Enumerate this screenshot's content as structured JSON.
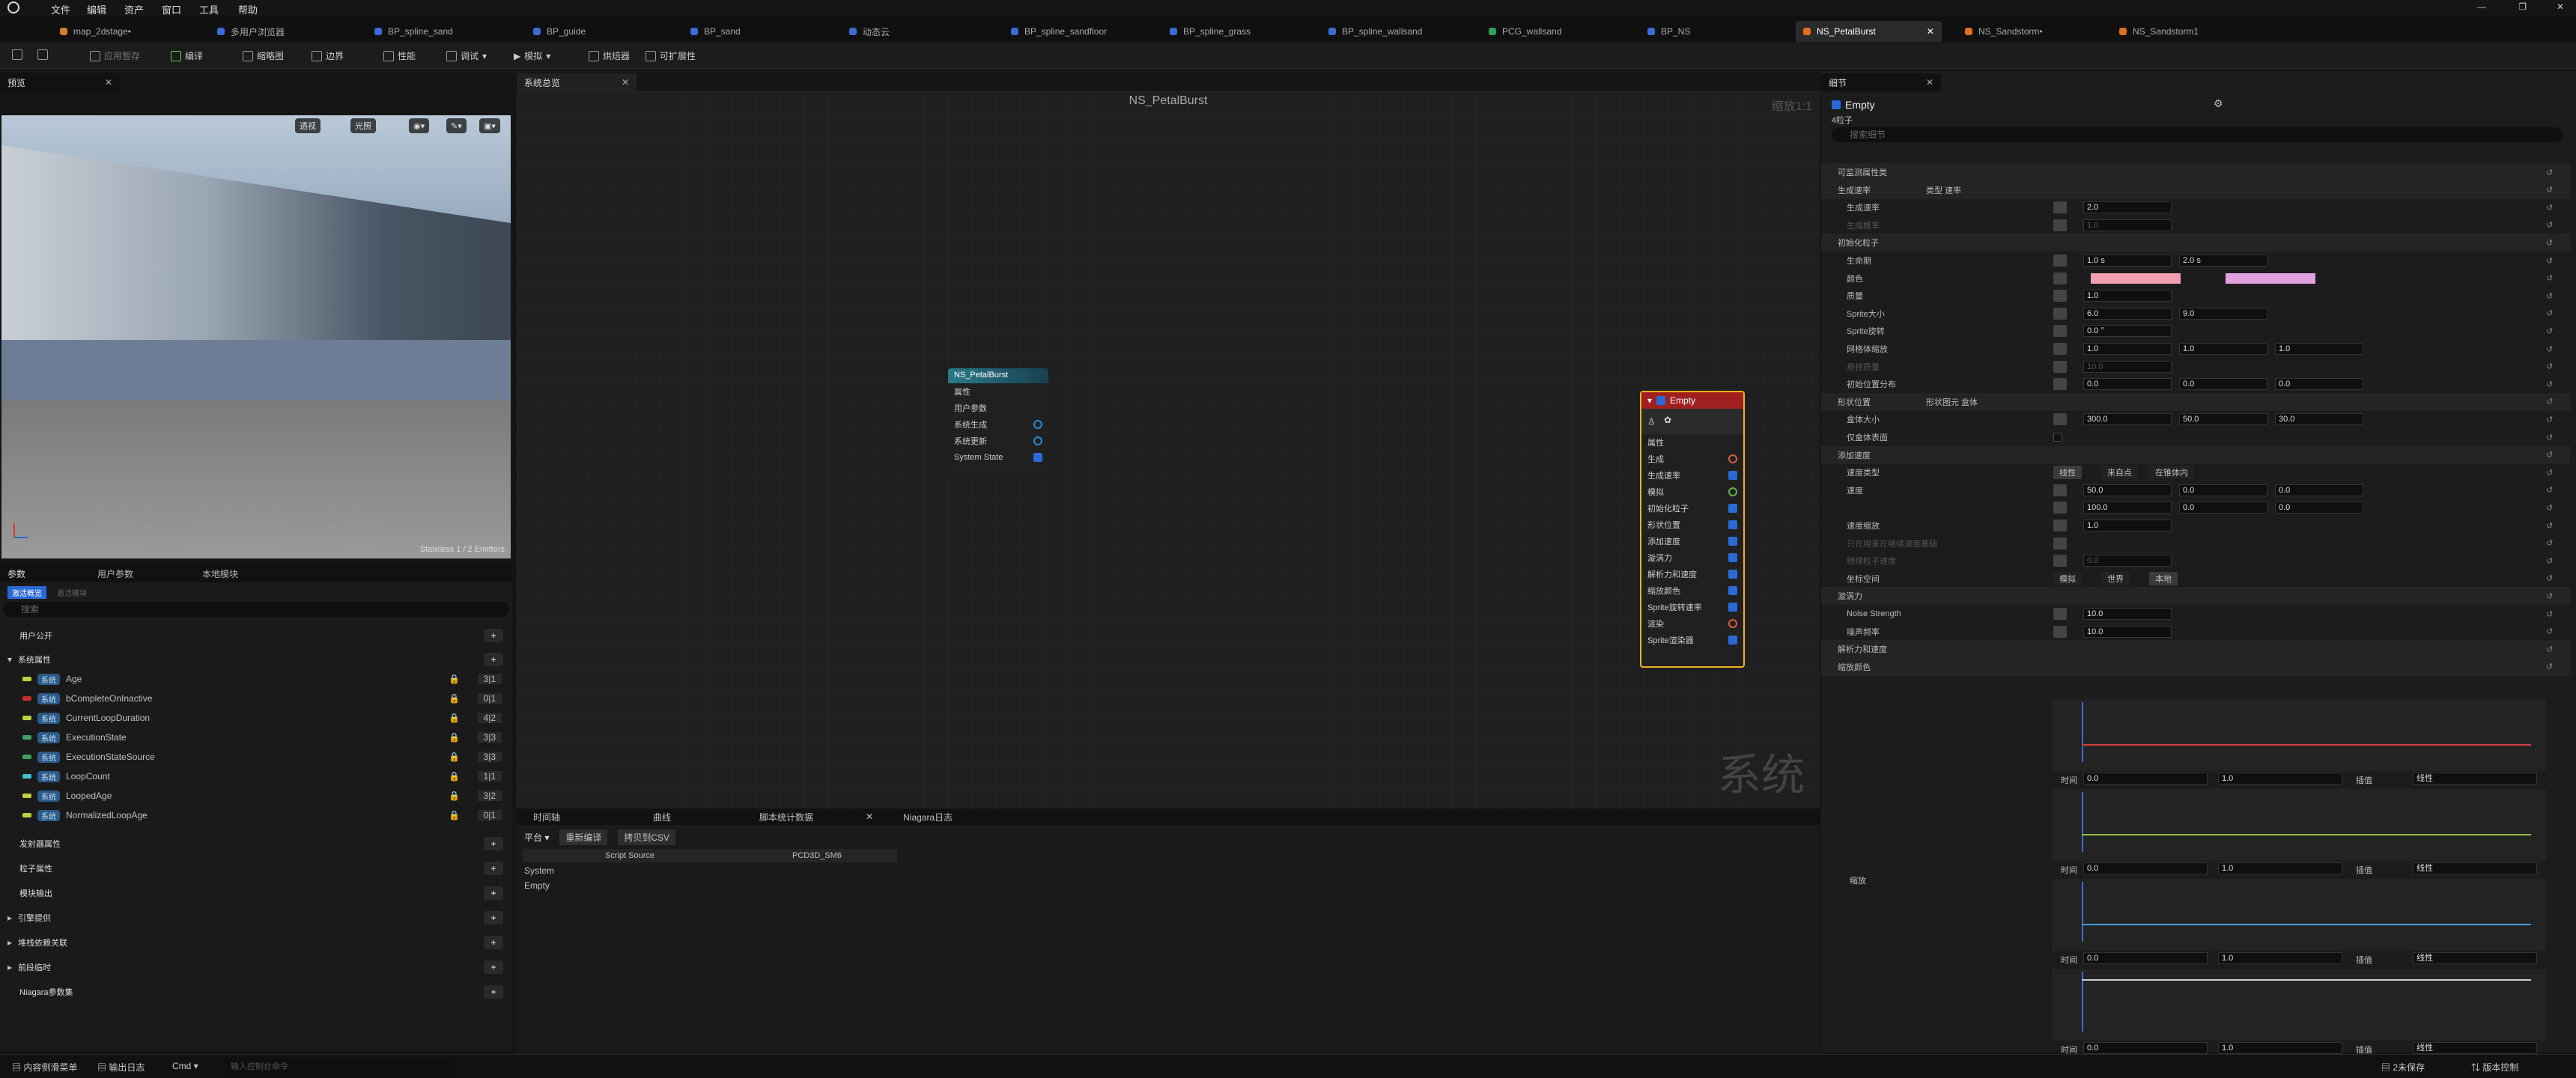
{
  "menu": [
    "文件",
    "编辑",
    "资产",
    "窗口",
    "工具",
    "帮助"
  ],
  "tabs": [
    "map_2dstage•",
    "多用户浏览器",
    "BP_spline_sand",
    "BP_guide",
    "BP_sand",
    "动态云",
    "BP_spline_sandfloor",
    "BP_spline_grass",
    "BP_spline_wallsand",
    "PCG_wallsand",
    "BP_NS",
    "NS_PetalBurst",
    "NS_Sandstorm•",
    "NS_Sandstorm1"
  ],
  "toolbar": {
    "apply": "应用暂存",
    "compile": "编译",
    "thumbnail": "缩略图",
    "bounds": "边界",
    "perf": "性能",
    "debug": "调试",
    "simulate": "模拟",
    "baker": "烘焙器",
    "scalability": "可扩展性"
  },
  "preview": {
    "title": "预览",
    "perspective": "透视",
    "lit": "光照",
    "stats": "Stateless 1 / 2 Emitters"
  },
  "params": {
    "title": "参数",
    "user_tab": "用户参数",
    "local_tab": "本地模块",
    "active_tab": "激活概览",
    "inactive_tab": "激活模块",
    "search_placeholder": "搜索",
    "user_exposed": "用户公开",
    "system_attr": "系统属性",
    "emitter_attr": "发射器属性",
    "particle_attr": "粒子属性",
    "module_output": "模块输出",
    "engine_provided": "引擎提供",
    "transient_assoc": "堆栈依赖关联",
    "before_temp": "前段临时",
    "niagara_params": "Niagara参数集",
    "attrs": [
      {
        "name": "Age",
        "count": "3|1",
        "color": "#c0d040"
      },
      {
        "name": "bCompleteOnInactive",
        "count": "0|1",
        "color": "#c03030"
      },
      {
        "name": "CurrentLoopDuration",
        "count": "4|2",
        "color": "#c0d040"
      },
      {
        "name": "ExecutionState",
        "count": "3|3",
        "color": "#40a060"
      },
      {
        "name": "ExecutionStateSource",
        "count": "3|3",
        "color": "#40a060"
      },
      {
        "name": "LoopCount",
        "count": "1|1",
        "color": "#40c0d0"
      },
      {
        "name": "LoopedAge",
        "count": "3|2",
        "color": "#c0d040"
      },
      {
        "name": "NormalizedLoopAge",
        "count": "0|1",
        "color": "#c0d040"
      }
    ],
    "sys_tag": "系统"
  },
  "graph": {
    "tab": "系统总览",
    "title": "NS_PetalBurst",
    "zoom": "缩放1:1",
    "watermark": "系统",
    "sys_node": {
      "title": "NS_PetalBurst",
      "rows": [
        "属性",
        "用户参数",
        "系统生成",
        "系统更新",
        "System State"
      ]
    },
    "emit_node": {
      "title": "Empty",
      "rows": [
        "属性",
        "生成",
        "生成速率",
        "模拟",
        "初始化粒子",
        "形状位置",
        "添加速度",
        "漩涡力",
        "解析力和速度",
        "缩放颜色",
        "Sprite旋转速率",
        "渲染",
        "Sprite渲染器"
      ]
    }
  },
  "bottom": {
    "tabs": [
      "时间轴",
      "曲线",
      "脚本统计数据",
      "Niagara日志"
    ],
    "platform": "平台",
    "recompile": "重新编译",
    "copy_csv": "拷贝到CSV",
    "col1": "Script Source",
    "col2": "PCD3D_SM6",
    "rows": [
      "System",
      "Empty"
    ]
  },
  "details": {
    "title": "细节",
    "emitter": "Empty",
    "count": "4粒子",
    "search_placeholder": "搜索细节",
    "rows": [
      {
        "l": "可监测属性类",
        "s": 1
      },
      {
        "l": "生成速率",
        "s": 1,
        "extra": "类型  速率"
      },
      {
        "l": "生成速率",
        "v": "2.0"
      },
      {
        "l": "生成概率",
        "v": "1.0",
        "dim": 1
      },
      {
        "l": "初始化粒子",
        "s": 1
      },
      {
        "l": "生命期",
        "v": "1.0 s",
        "v2": "2.0 s"
      },
      {
        "l": "颜色",
        "color": 1
      },
      {
        "l": "质量",
        "v": "1.0"
      },
      {
        "l": "Sprite大小",
        "v": "6.0",
        "v2": "9.0"
      },
      {
        "l": "Sprite旋转",
        "v": "0.0 °"
      },
      {
        "l": "网格体缩放",
        "v": "1.0",
        "v2": "1.0",
        "v3": "1.0"
      },
      {
        "l": "悬挂质量",
        "v": "10.0",
        "dim": 1
      },
      {
        "l": "初始位置分布",
        "v": "0.0",
        "v2": "0.0",
        "v3": "0.0"
      },
      {
        "l": "形状位置",
        "s": 1,
        "extra": "形状图元  盒体"
      },
      {
        "l": "盒体大小",
        "v": "300.0",
        "v2": "50.0",
        "v3": "30.0"
      },
      {
        "l": "仅盒体表面"
      },
      {
        "l": "添加速度",
        "s": 1
      },
      {
        "l": "速度类型",
        "mode": [
          "线性",
          "来自点",
          "在锥体内"
        ]
      },
      {
        "l": "速度",
        "v": "50.0",
        "v2": "0.0",
        "v3": "0.0"
      },
      {
        "l": "",
        "v": "100.0",
        "v2": "0.0",
        "v3": "0.0"
      },
      {
        "l": "速度缩放",
        "v": "1.0"
      },
      {
        "l": "只在用来在继续速度基础",
        "dim": 1
      },
      {
        "l": "继续粒子速度",
        "v": "0.0",
        "dim": 1
      },
      {
        "l": "坐标空间",
        "mode": [
          "模拟",
          "世界",
          "本地"
        ]
      },
      {
        "l": "漩涡力",
        "s": 1
      },
      {
        "l": "Noise Strength",
        "v": "10.0"
      },
      {
        "l": "噪声频率",
        "v": "10.0"
      },
      {
        "l": "解析力和速度",
        "s": 1
      },
      {
        "l": "缩放颜色",
        "s": 1
      }
    ],
    "colors": {
      "min": "#f0a0b0",
      "max": "#e0a0e0"
    },
    "curve_label": "缩放",
    "curves": [
      {
        "t": "时间",
        "v0": "0.0",
        "v1": "1.0",
        "interp": "插值",
        "mode": "线性",
        "color": "#d04040"
      },
      {
        "t": "时间",
        "v0": "0.0",
        "v1": "1.0",
        "interp": "插值",
        "mode": "线性",
        "color": "#90c040"
      },
      {
        "t": "时间",
        "v0": "0.0",
        "v1": "1.0",
        "interp": "插值",
        "mode": "线性",
        "color": "#40a0e0"
      },
      {
        "t": "时间",
        "v0": "0.0",
        "v1": "1.0",
        "interp": "插值",
        "mode": "线性",
        "color": "#cccccc"
      }
    ]
  },
  "status": {
    "content": "内容侧滑菜单",
    "output": "输出日志",
    "cmd": "Cmd",
    "console_placeholder": "输入控制台命令",
    "unsaved": "2未保存",
    "version": "版本控制"
  }
}
